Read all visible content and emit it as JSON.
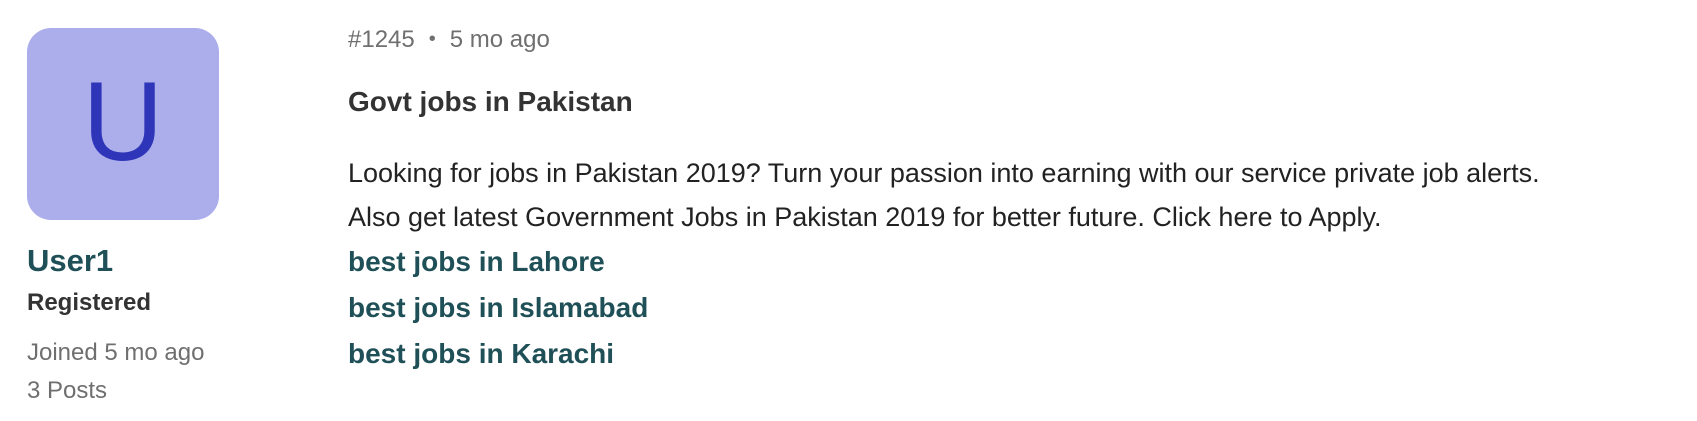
{
  "colors": {
    "avatar_bg": "#abaeeb",
    "avatar_fg": "#2f35b8",
    "link": "#1f5057"
  },
  "author": {
    "avatar_letter": "U",
    "name": "User1",
    "role": "Registered",
    "joined": "Joined 5 mo ago",
    "posts": "3 Posts"
  },
  "post": {
    "id": "#1245",
    "separator": "•",
    "time": "5 mo ago",
    "title": "Govt jobs in Pakistan",
    "body_lines": [
      "Looking for jobs in Pakistan 2019? Turn your passion into earning with our service private job alerts.",
      "Also get latest Government Jobs in Pakistan 2019 for better future. Click here to Apply."
    ],
    "links": [
      "best jobs in Lahore",
      "best jobs in Islamabad",
      "best jobs in Karachi"
    ]
  }
}
